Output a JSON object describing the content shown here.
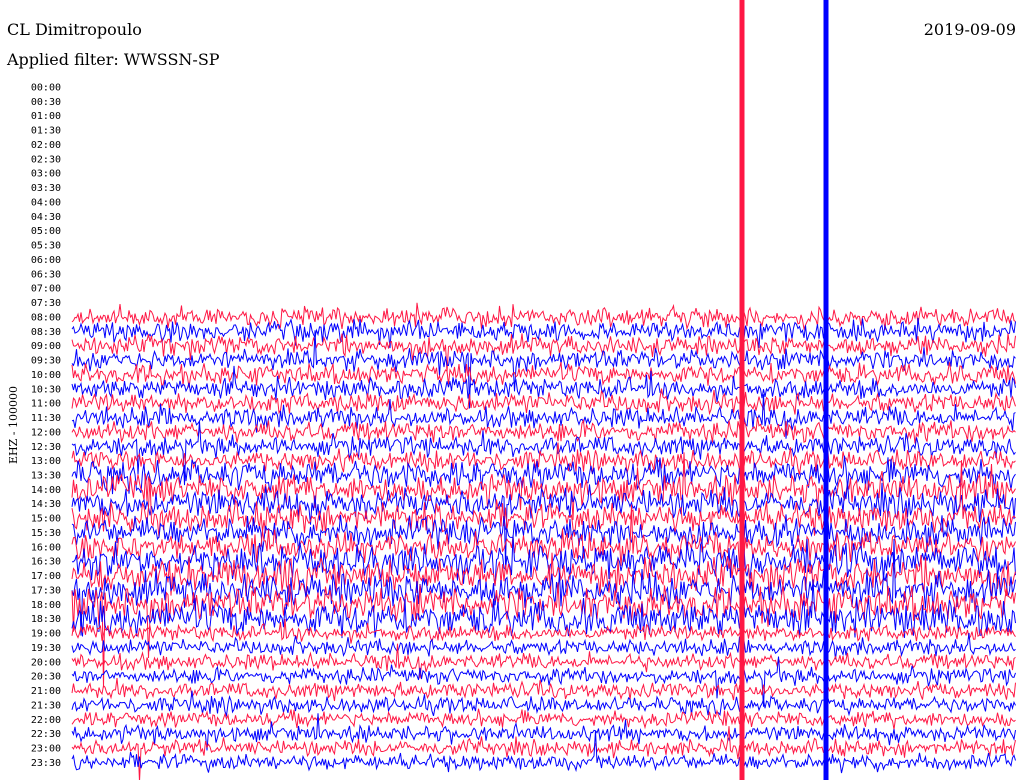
{
  "header": {
    "station": "CL Dimitropoulo",
    "filter": "Applied filter: WWSSN-SP",
    "date": "2019-09-09"
  },
  "colors": {
    "odd": "#ff1744",
    "even": "#0000ff",
    "background": "#ffffff"
  },
  "chart_data": {
    "type": "line",
    "title": "",
    "ylabel": "EHZ - 100000",
    "xlabel": "",
    "grid": false,
    "legend": "none",
    "row_labels": [
      "00:00",
      "00:30",
      "01:00",
      "01:30",
      "02:00",
      "02:30",
      "03:00",
      "03:30",
      "04:00",
      "04:30",
      "05:00",
      "05:30",
      "06:00",
      "06:30",
      "07:00",
      "07:30",
      "08:00",
      "08:30",
      "09:00",
      "09:30",
      "10:00",
      "10:30",
      "11:00",
      "11:30",
      "12:00",
      "12:30",
      "13:00",
      "13:30",
      "14:00",
      "14:30",
      "15:00",
      "15:30",
      "16:00",
      "16:30",
      "17:00",
      "17:30",
      "18:00",
      "18:30",
      "19:00",
      "19:30",
      "20:00",
      "20:30",
      "21:00",
      "21:30",
      "22:00",
      "22:30",
      "23:00",
      "23:30"
    ],
    "first_recorded_row": "08:00",
    "series_colors": [
      "#ff1744",
      "#0000ff"
    ]
  }
}
